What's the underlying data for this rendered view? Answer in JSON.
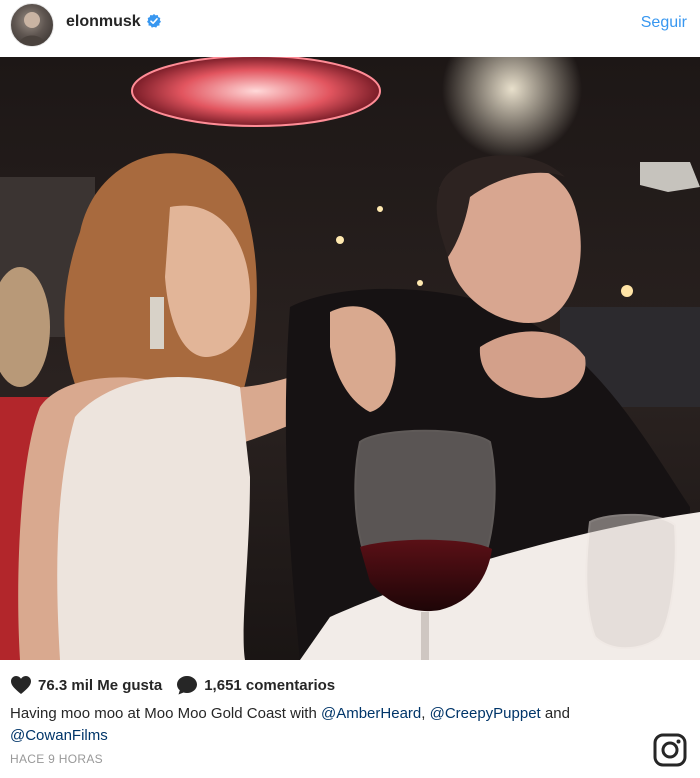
{
  "header": {
    "username": "elonmusk",
    "verified": true,
    "follow_label": "Seguir"
  },
  "post": {
    "image_alt": "",
    "likes_label": "76.3 mil Me gusta",
    "comments_label": "1,651 comentarios",
    "caption": {
      "text_1": "Having moo moo at Moo Moo Gold Coast with ",
      "mention_1": "@AmberHeard",
      "sep_1": ", ",
      "mention_2": "@CreepyPuppet",
      "text_2": " and ",
      "mention_3": "@CowanFilms"
    },
    "timestamp": "HACE 9 HORAS"
  },
  "colors": {
    "link": "#3897f0",
    "mention": "#003569",
    "muted": "#999999"
  },
  "icons": [
    "verified-badge-icon",
    "heart-icon",
    "comment-bubble-icon",
    "instagram-logo-icon"
  ]
}
